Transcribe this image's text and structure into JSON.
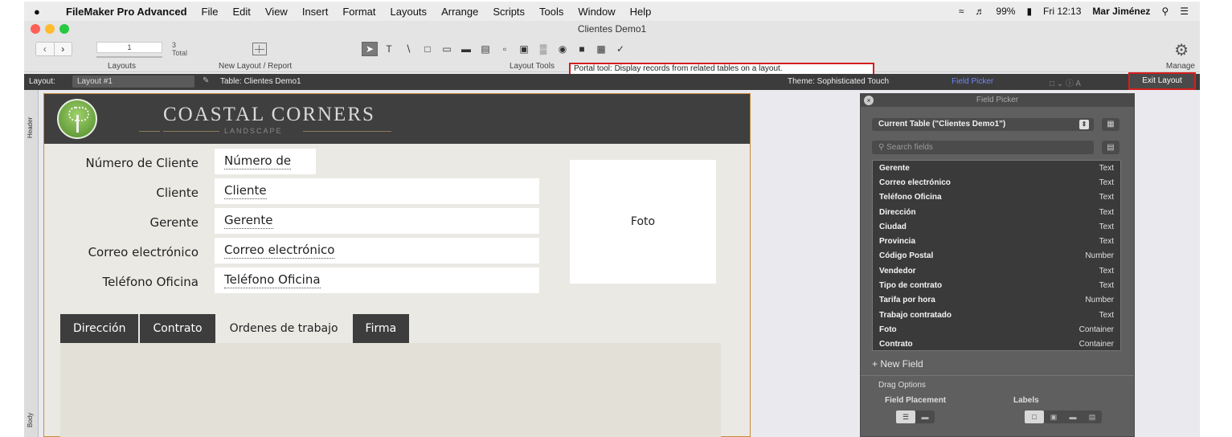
{
  "menubar": {
    "app_name": "FileMaker Pro Advanced",
    "menus": [
      "File",
      "Edit",
      "View",
      "Insert",
      "Format",
      "Layouts",
      "Arrange",
      "Scripts",
      "Tools",
      "Window",
      "Help"
    ],
    "battery": "99%",
    "clock": "Fri 12:13",
    "user": "Mar Jiménez"
  },
  "window": {
    "title": "Clientes Demo1"
  },
  "toolbar": {
    "record_value": "1",
    "total_count": "3",
    "total_label": "Total",
    "layouts_label": "Layouts",
    "new_layout_label": "New Layout / Report",
    "layout_tools_label": "Layout Tools",
    "manage_label": "Manage"
  },
  "tooltip": "Portal tool: Display records from related tables on a layout.",
  "layoutbar": {
    "layout_label": "Layout:",
    "layout_name": "Layout #1",
    "table_label": "Table: Clientes Demo1",
    "theme_label": "Theme: Sophisticated Touch",
    "field_picker_label": "Field Picker",
    "exit_label": "Exit Layout"
  },
  "parts": {
    "header": "Header",
    "body": "Body"
  },
  "layout": {
    "company_name": "COASTAL CORNERS",
    "company_sub": "LANDSCAPE",
    "fields": [
      {
        "label": "Número de Cliente",
        "value": "Número de"
      },
      {
        "label": "Cliente",
        "value": "Cliente"
      },
      {
        "label": "Gerente",
        "value": "Gerente"
      },
      {
        "label": "Correo electrónico",
        "value": "Correo electrónico"
      },
      {
        "label": "Teléfono Oficina",
        "value": "Teléfono Oficina"
      }
    ],
    "photo_label": "Foto",
    "tabs": [
      "Dirección",
      "Contrato",
      "Ordenes de trabajo",
      "Firma"
    ],
    "active_tab": "Ordenes de trabajo"
  },
  "picker": {
    "title": "Field Picker",
    "table_select": "Current Table (\"Clientes Demo1\")",
    "search_placeholder": "Search fields",
    "fields": [
      {
        "name": "Gerente",
        "type": "Text"
      },
      {
        "name": "Correo electrónico",
        "type": "Text"
      },
      {
        "name": "Teléfono Oficina",
        "type": "Text"
      },
      {
        "name": "Dirección",
        "type": "Text"
      },
      {
        "name": "Ciudad",
        "type": "Text"
      },
      {
        "name": "Provincia",
        "type": "Text"
      },
      {
        "name": "Código Postal",
        "type": "Number"
      },
      {
        "name": "Vendedor",
        "type": "Text"
      },
      {
        "name": "Tipo de contrato",
        "type": "Text"
      },
      {
        "name": "Tarifa por hora",
        "type": "Number"
      },
      {
        "name": "Trabajo contratado",
        "type": "Text"
      },
      {
        "name": "Foto",
        "type": "Container"
      },
      {
        "name": "Contrato",
        "type": "Container"
      }
    ],
    "new_field": "+ New Field",
    "drag_options": "Drag Options",
    "field_placement": "Field Placement",
    "labels": "Labels"
  },
  "colors": {
    "accent_red": "#d21f1f",
    "header_dark": "#3f3f3f",
    "picker_bg": "#5f5f5f"
  }
}
